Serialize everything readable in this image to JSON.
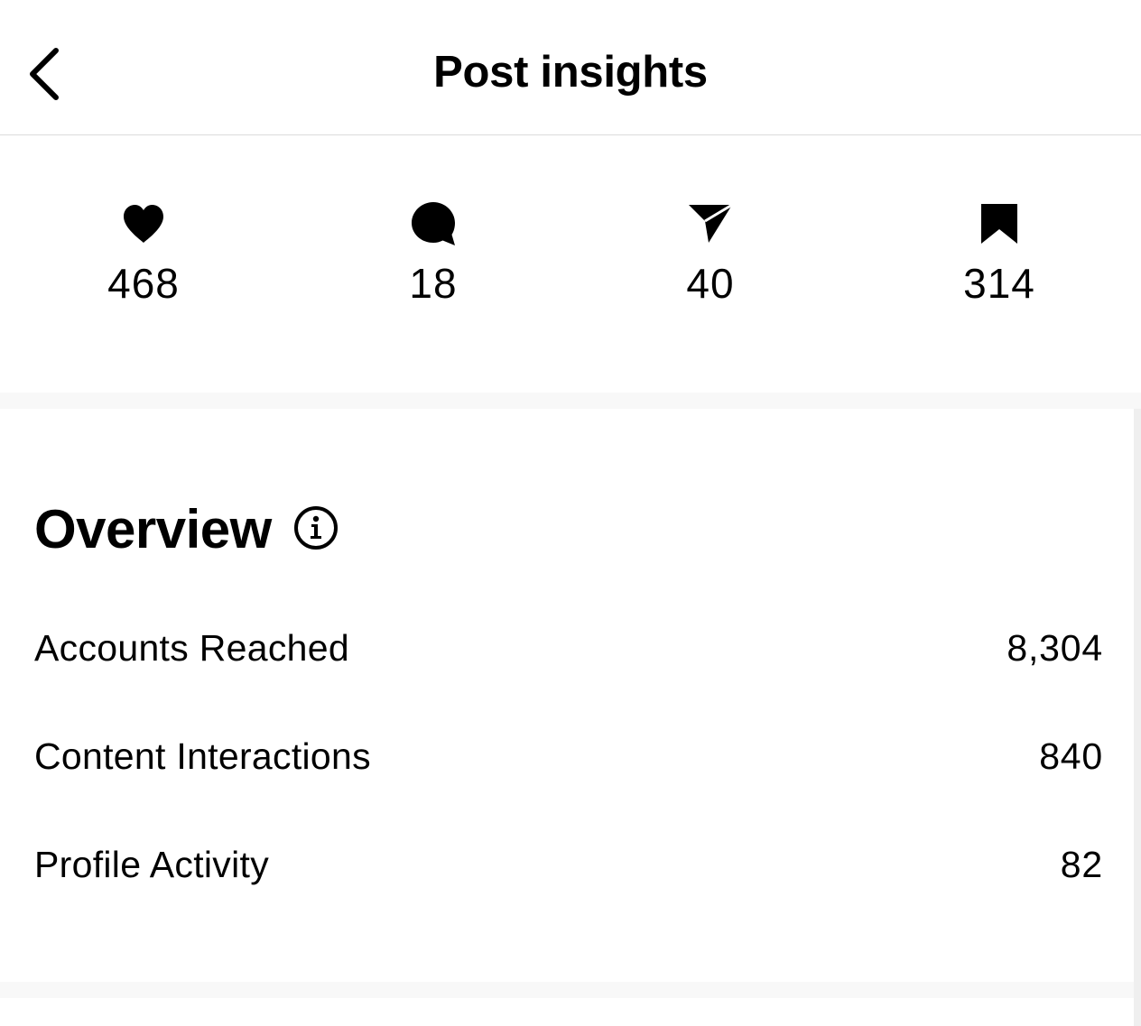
{
  "header": {
    "title": "Post insights",
    "back_icon": "chevron-left-icon"
  },
  "stats": [
    {
      "icon": "heart-icon",
      "label": "Likes",
      "value": "468"
    },
    {
      "icon": "comment-icon",
      "label": "Comments",
      "value": "18"
    },
    {
      "icon": "send-icon",
      "label": "Shares",
      "value": "40"
    },
    {
      "icon": "bookmark-icon",
      "label": "Saves",
      "value": "314"
    }
  ],
  "overview": {
    "title": "Overview",
    "info_icon": "info-icon",
    "rows": [
      {
        "label": "Accounts Reached",
        "value": "8,304"
      },
      {
        "label": "Content Interactions",
        "value": "840"
      },
      {
        "label": "Profile Activity",
        "value": "82"
      }
    ]
  },
  "colors": {
    "text": "#000000",
    "divider": "#dbdbdb",
    "section_gap": "#f8f8f8"
  }
}
